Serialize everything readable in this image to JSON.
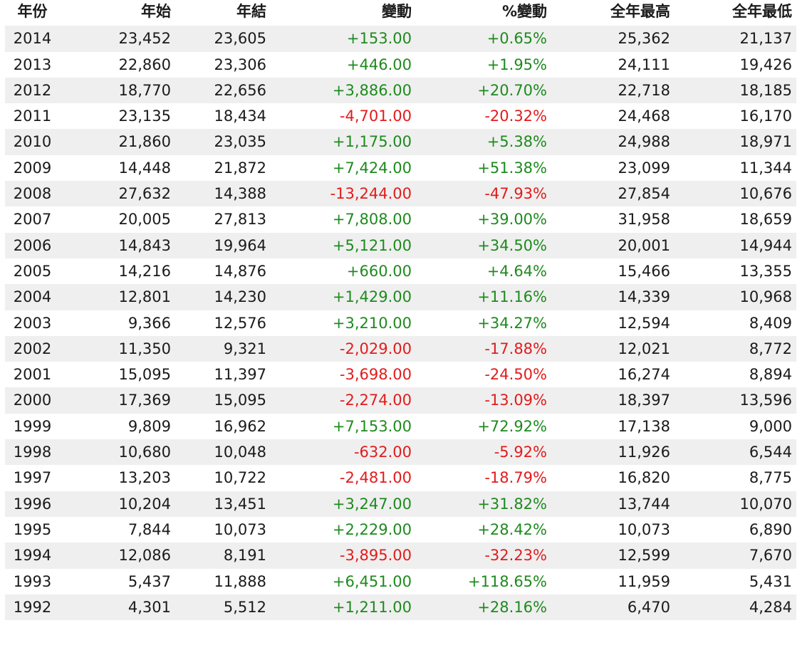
{
  "table": {
    "headers": [
      "年份",
      "年始",
      "年結",
      "變動",
      "%變動",
      "全年最高",
      "全年最低"
    ],
    "rows": [
      {
        "year": "2014",
        "open": "23,452",
        "close": "23,605",
        "change": "+153.00",
        "pct": "+0.65%",
        "high": "25,362",
        "low": "21,137",
        "dir": "pos"
      },
      {
        "year": "2013",
        "open": "22,860",
        "close": "23,306",
        "change": "+446.00",
        "pct": "+1.95%",
        "high": "24,111",
        "low": "19,426",
        "dir": "pos"
      },
      {
        "year": "2012",
        "open": "18,770",
        "close": "22,656",
        "change": "+3,886.00",
        "pct": "+20.70%",
        "high": "22,718",
        "low": "18,185",
        "dir": "pos"
      },
      {
        "year": "2011",
        "open": "23,135",
        "close": "18,434",
        "change": "-4,701.00",
        "pct": "-20.32%",
        "high": "24,468",
        "low": "16,170",
        "dir": "neg"
      },
      {
        "year": "2010",
        "open": "21,860",
        "close": "23,035",
        "change": "+1,175.00",
        "pct": "+5.38%",
        "high": "24,988",
        "low": "18,971",
        "dir": "pos"
      },
      {
        "year": "2009",
        "open": "14,448",
        "close": "21,872",
        "change": "+7,424.00",
        "pct": "+51.38%",
        "high": "23,099",
        "low": "11,344",
        "dir": "pos"
      },
      {
        "year": "2008",
        "open": "27,632",
        "close": "14,388",
        "change": "-13,244.00",
        "pct": "-47.93%",
        "high": "27,854",
        "low": "10,676",
        "dir": "neg"
      },
      {
        "year": "2007",
        "open": "20,005",
        "close": "27,813",
        "change": "+7,808.00",
        "pct": "+39.00%",
        "high": "31,958",
        "low": "18,659",
        "dir": "pos"
      },
      {
        "year": "2006",
        "open": "14,843",
        "close": "19,964",
        "change": "+5,121.00",
        "pct": "+34.50%",
        "high": "20,001",
        "low": "14,944",
        "dir": "pos"
      },
      {
        "year": "2005",
        "open": "14,216",
        "close": "14,876",
        "change": "+660.00",
        "pct": "+4.64%",
        "high": "15,466",
        "low": "13,355",
        "dir": "pos"
      },
      {
        "year": "2004",
        "open": "12,801",
        "close": "14,230",
        "change": "+1,429.00",
        "pct": "+11.16%",
        "high": "14,339",
        "low": "10,968",
        "dir": "pos"
      },
      {
        "year": "2003",
        "open": "9,366",
        "close": "12,576",
        "change": "+3,210.00",
        "pct": "+34.27%",
        "high": "12,594",
        "low": "8,409",
        "dir": "pos"
      },
      {
        "year": "2002",
        "open": "11,350",
        "close": "9,321",
        "change": "-2,029.00",
        "pct": "-17.88%",
        "high": "12,021",
        "low": "8,772",
        "dir": "neg"
      },
      {
        "year": "2001",
        "open": "15,095",
        "close": "11,397",
        "change": "-3,698.00",
        "pct": "-24.50%",
        "high": "16,274",
        "low": "8,894",
        "dir": "neg"
      },
      {
        "year": "2000",
        "open": "17,369",
        "close": "15,095",
        "change": "-2,274.00",
        "pct": "-13.09%",
        "high": "18,397",
        "low": "13,596",
        "dir": "neg"
      },
      {
        "year": "1999",
        "open": "9,809",
        "close": "16,962",
        "change": "+7,153.00",
        "pct": "+72.92%",
        "high": "17,138",
        "low": "9,000",
        "dir": "pos"
      },
      {
        "year": "1998",
        "open": "10,680",
        "close": "10,048",
        "change": "-632.00",
        "pct": "-5.92%",
        "high": "11,926",
        "low": "6,544",
        "dir": "neg"
      },
      {
        "year": "1997",
        "open": "13,203",
        "close": "10,722",
        "change": "-2,481.00",
        "pct": "-18.79%",
        "high": "16,820",
        "low": "8,775",
        "dir": "neg"
      },
      {
        "year": "1996",
        "open": "10,204",
        "close": "13,451",
        "change": "+3,247.00",
        "pct": "+31.82%",
        "high": "13,744",
        "low": "10,070",
        "dir": "pos"
      },
      {
        "year": "1995",
        "open": "7,844",
        "close": "10,073",
        "change": "+2,229.00",
        "pct": "+28.42%",
        "high": "10,073",
        "low": "6,890",
        "dir": "pos"
      },
      {
        "year": "1994",
        "open": "12,086",
        "close": "8,191",
        "change": "-3,895.00",
        "pct": "-32.23%",
        "high": "12,599",
        "low": "7,670",
        "dir": "neg"
      },
      {
        "year": "1993",
        "open": "5,437",
        "close": "11,888",
        "change": "+6,451.00",
        "pct": "+118.65%",
        "high": "11,959",
        "low": "5,431",
        "dir": "pos"
      },
      {
        "year": "1992",
        "open": "4,301",
        "close": "5,512",
        "change": "+1,211.00",
        "pct": "+28.16%",
        "high": "6,470",
        "low": "4,284",
        "dir": "pos"
      }
    ]
  },
  "colors": {
    "positive": "#1e8a1e",
    "negative": "#e31b1b",
    "stripe": "#efefef",
    "text": "#1a1a1a"
  }
}
